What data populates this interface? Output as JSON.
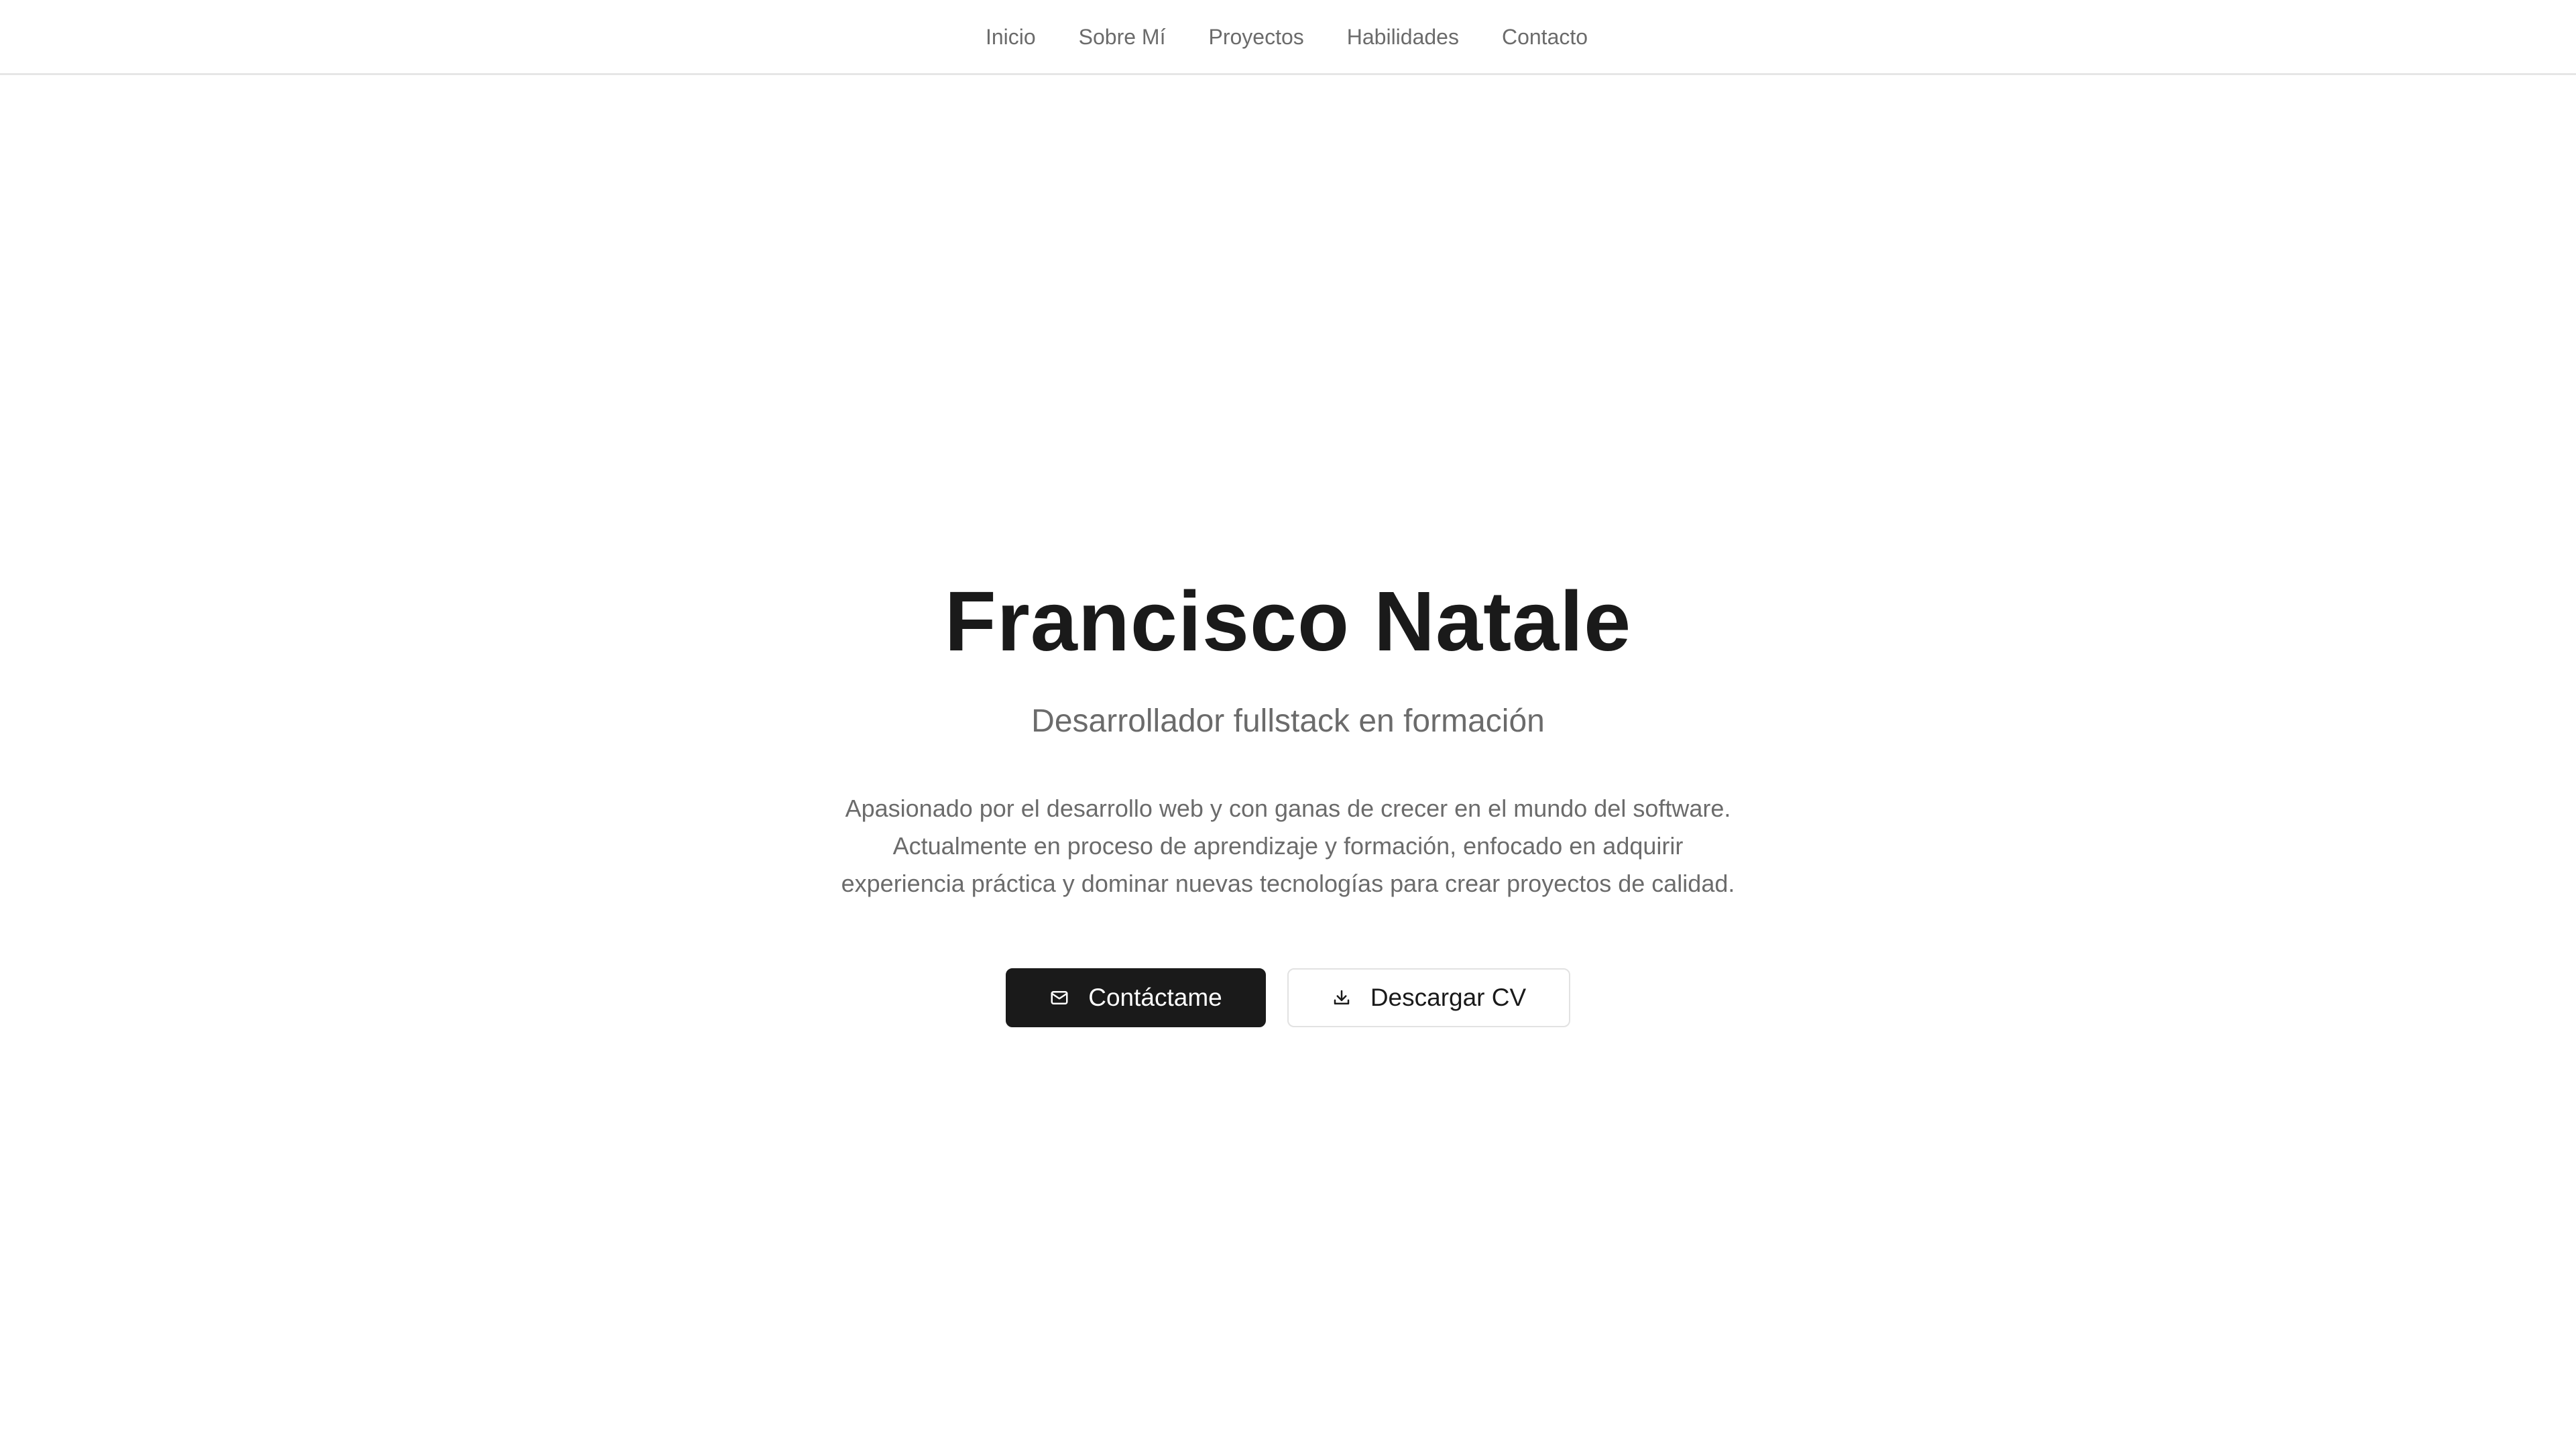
{
  "nav": {
    "items": [
      {
        "label": "Inicio"
      },
      {
        "label": "Sobre Mí"
      },
      {
        "label": "Proyectos"
      },
      {
        "label": "Habilidades"
      },
      {
        "label": "Contacto"
      }
    ]
  },
  "hero": {
    "name": "Francisco Natale",
    "subtitle": "Desarrollador fullstack en formación",
    "description_lines": [
      "Apasionado por el desarrollo web y con ganas de crecer en el mundo del software.",
      "Actualmente en proceso de aprendizaje y formación, enfocado en adquirir",
      "experiencia práctica y dominar nuevas tecnologías para crear proyectos de calidad."
    ],
    "contact_button": {
      "label": "Contáctame",
      "icon": "mail-icon"
    },
    "cv_button": {
      "label": "Descargar CV",
      "icon": "download-icon"
    }
  },
  "colors": {
    "text_primary": "#1a1a1a",
    "text_muted": "#6b6b6b",
    "primary_button_bg": "#1a1a1a",
    "background": "#ffffff",
    "border": "#e2e2e2"
  }
}
